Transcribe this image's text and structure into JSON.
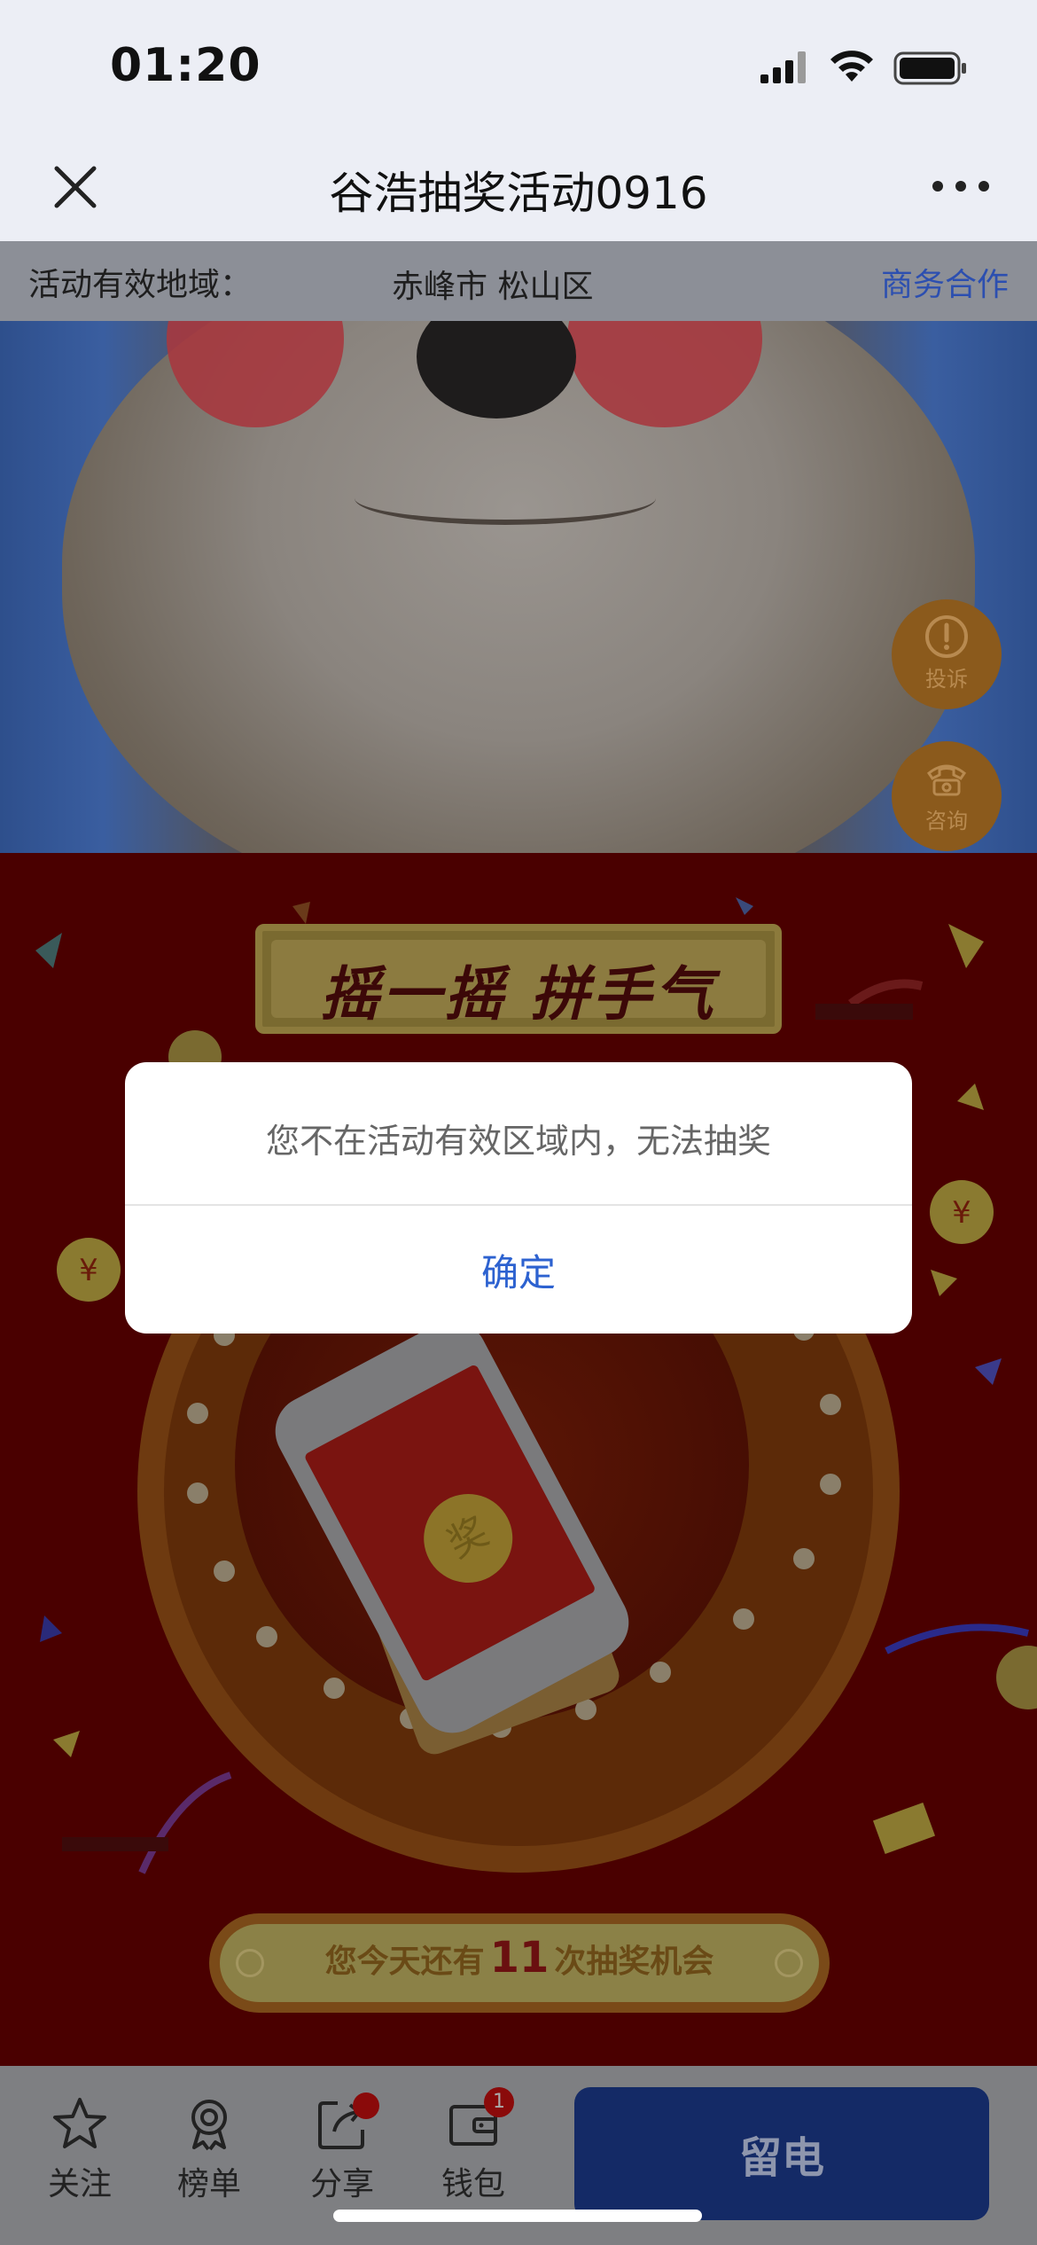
{
  "status_bar": {
    "time": "01:20",
    "signal_icon": "cellular-signal-icon",
    "wifi_icon": "wifi-icon",
    "battery_icon": "battery-icon"
  },
  "nav": {
    "title": "谷浩抽奖活动0916",
    "close_icon": "close-icon",
    "more_icon": "more-dots-icon"
  },
  "region_bar": {
    "label": "活动有效地域：",
    "value": "赤峰市 松山区",
    "business_link": "商务合作",
    "link_color": "#2c4fb0"
  },
  "side_buttons": {
    "complain": "投诉",
    "consult": "咨询"
  },
  "event": {
    "title": "摇一摇 拼手气",
    "coin_char": "奖",
    "chance_prefix": "您今天还有",
    "chance_count": "11",
    "chance_suffix": "次抽奖机会"
  },
  "dialog": {
    "message": "您不在活动有效区域内，无法抽奖",
    "confirm_label": "确定",
    "confirm_color": "#2d62d0"
  },
  "tab_bar": {
    "items": [
      {
        "label": "关注",
        "icon": "star-icon"
      },
      {
        "label": "榜单",
        "icon": "award-ribbon-icon"
      },
      {
        "label": "分享",
        "icon": "share-icon",
        "badge": "dot"
      },
      {
        "label": "钱包",
        "icon": "wallet-icon",
        "badge": "1"
      }
    ],
    "primary_button": "留电",
    "primary_color": "#1c3a94"
  }
}
